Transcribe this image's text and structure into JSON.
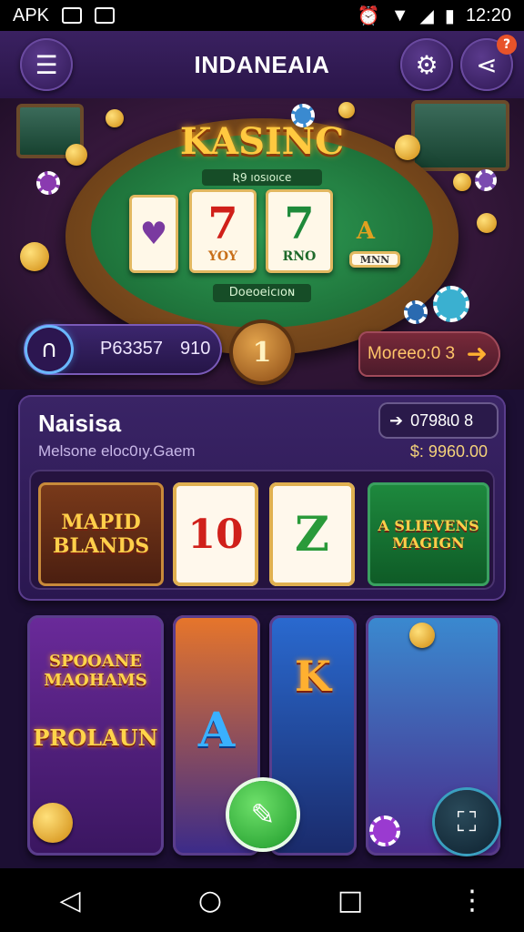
{
  "status_bar": {
    "carrier": "APK",
    "time": "12:20"
  },
  "app_bar": {
    "title": "INDANEAIA",
    "notification_count": "?"
  },
  "hero": {
    "title": "KASINC",
    "felt_label_top": "Ʀ9 ıosıoıce",
    "felt_label_bottom": "Doeoeicıoɴ",
    "cards": [
      "7",
      "7",
      "A"
    ],
    "card_subtexts": [
      "YOY",
      "RNO",
      "MNN"
    ],
    "balance_primary": "P63357",
    "balance_secondary": "910",
    "level": "1",
    "more_label": "Moɾeeo:0 3"
  },
  "panel": {
    "title": "Naisisa",
    "subtitle": "Melsone eloc0ıy.Gaem",
    "jackpot_label": "0798ɩ0 8",
    "jackpot_value": "$: 9960.00",
    "tiles": [
      {
        "label": "MAPID BLANDS"
      },
      {
        "label": "10"
      },
      {
        "label": "Z"
      },
      {
        "label": "A SLIEVENS MAGIGN"
      }
    ]
  },
  "games": [
    {
      "title_top": "SPOOANE MAOHAMS",
      "title_bottom": "PROLAUN"
    },
    {
      "title_top": "A"
    },
    {
      "title_top": "K"
    },
    {
      "title_top": ""
    }
  ],
  "colors": {
    "accent_gold": "#ffc940",
    "felt_green": "#2f9e55",
    "panel_purple": "#3a2466"
  }
}
